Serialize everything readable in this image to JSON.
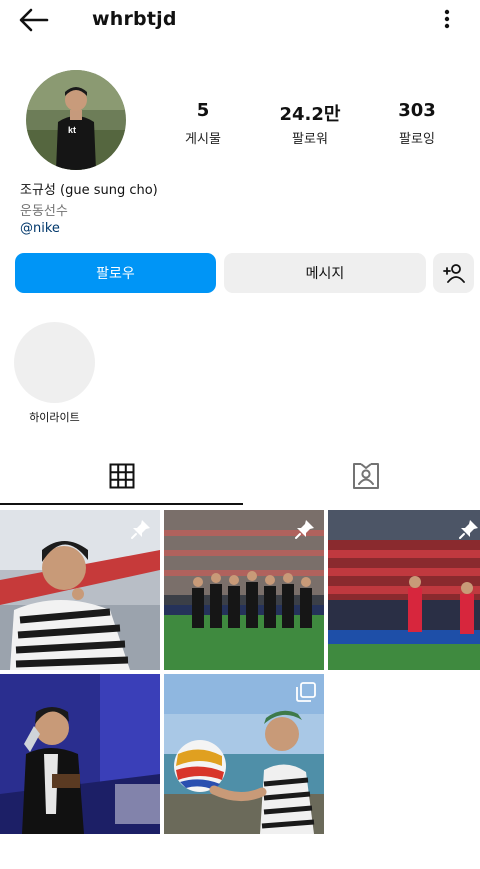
{
  "header": {
    "username": "whrbtjd",
    "back_icon": "arrow-left-icon",
    "more_icon": "more-vertical-icon"
  },
  "profile": {
    "stats": [
      {
        "value": "5",
        "label": "게시물"
      },
      {
        "value": "24.2만",
        "label": "팔로워"
      },
      {
        "value": "303",
        "label": "팔로잉"
      }
    ],
    "full_name": "조규성 (gue sung cho)",
    "category": "운동선수",
    "tag": "@nike"
  },
  "actions": {
    "follow_label": "팔로우",
    "message_label": "메시지",
    "suggest_icon": "person-add-icon"
  },
  "highlights": [
    {
      "label": "하이라이트"
    }
  ],
  "tabs": [
    {
      "icon": "grid-icon",
      "active": true
    },
    {
      "icon": "tagged-person-icon",
      "active": false
    }
  ],
  "posts": [
    {
      "pinned": true,
      "icon": "pin-icon"
    },
    {
      "pinned": true,
      "icon": "pin-icon"
    },
    {
      "pinned": true,
      "icon": "pin-icon"
    },
    {
      "pinned": false
    },
    {
      "pinned": false,
      "icon": "carousel-icon"
    }
  ],
  "colors": {
    "primary": "#0095f6",
    "secondary_bg": "#efefef",
    "link": "#00376b"
  }
}
